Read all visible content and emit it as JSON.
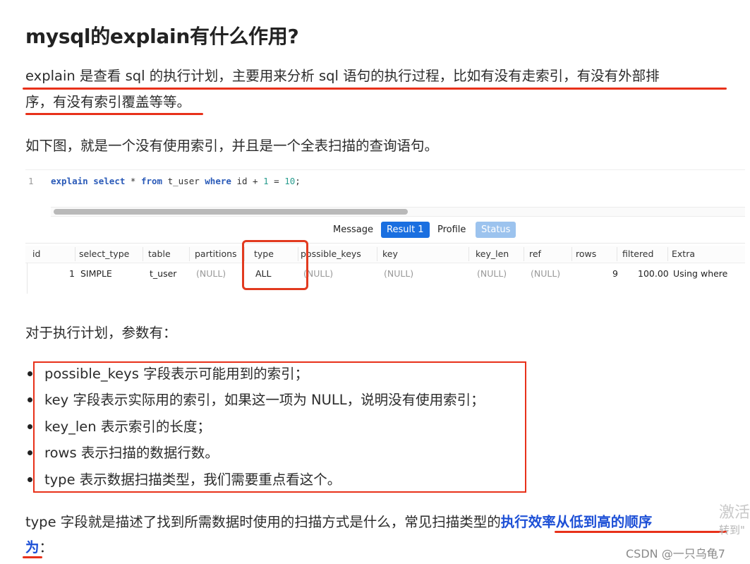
{
  "heading": "mysql的explain有什么作用?",
  "intro_line1": "explain 是查看 sql 的执行计划，主要用来分析 sql 语句的执行过程，比如有没有走索引，有没有外部排",
  "intro_line2": "序，有没有索引覆盖等等。",
  "desc": "如下图，就是一个没有使用索引，并且是一个全表扫描的查询语句。",
  "editor": {
    "line_no": "1",
    "code": {
      "kw1": "explain",
      "kw2": "select",
      "star": " * ",
      "kw3": "from",
      "table": " t_user ",
      "kw4": "where",
      "expr": " id + ",
      "n1": "1",
      "eq": " = ",
      "n2": "10",
      "end": ";"
    }
  },
  "tabs": {
    "message": "Message",
    "result": "Result 1",
    "profile": "Profile",
    "status": "Status"
  },
  "table": {
    "headers": [
      "id",
      "select_type",
      "table",
      "partitions",
      "type",
      "possible_keys",
      "key",
      "key_len",
      "ref",
      "rows",
      "filtered",
      "Extra"
    ],
    "row": [
      "1",
      "SIMPLE",
      "t_user",
      "(NULL)",
      "ALL",
      "(NULL)",
      "(NULL)",
      "(NULL)",
      "(NULL)",
      "9",
      "100.00",
      "Using where"
    ]
  },
  "params_title": "对于执行计划，参数有：",
  "params": [
    "possible_keys 字段表示可能用到的索引；",
    "key 字段表示实际用的索引，如果这一项为 NULL，说明没有使用索引；",
    "key_len 表示索引的长度；",
    "rows 表示扫描的数据行数。",
    "type 表示数据扫描类型，我们需要重点看这个。"
  ],
  "type_text_before": "type 字段就是描述了找到所需数据时使用的扫描方式是什么，常见扫描类型的",
  "type_link_1": "执行效率从低到高的顺序",
  "type_link_2": "为",
  "type_text_after": "：",
  "watermark_1": "激活",
  "watermark_2": "转到\"",
  "csdn": "CSDN @一只乌龟7",
  "colors": {
    "accent_red": "#e8311a",
    "link_blue": "#1c4fd6",
    "tab_blue": "#1a6fe0"
  }
}
